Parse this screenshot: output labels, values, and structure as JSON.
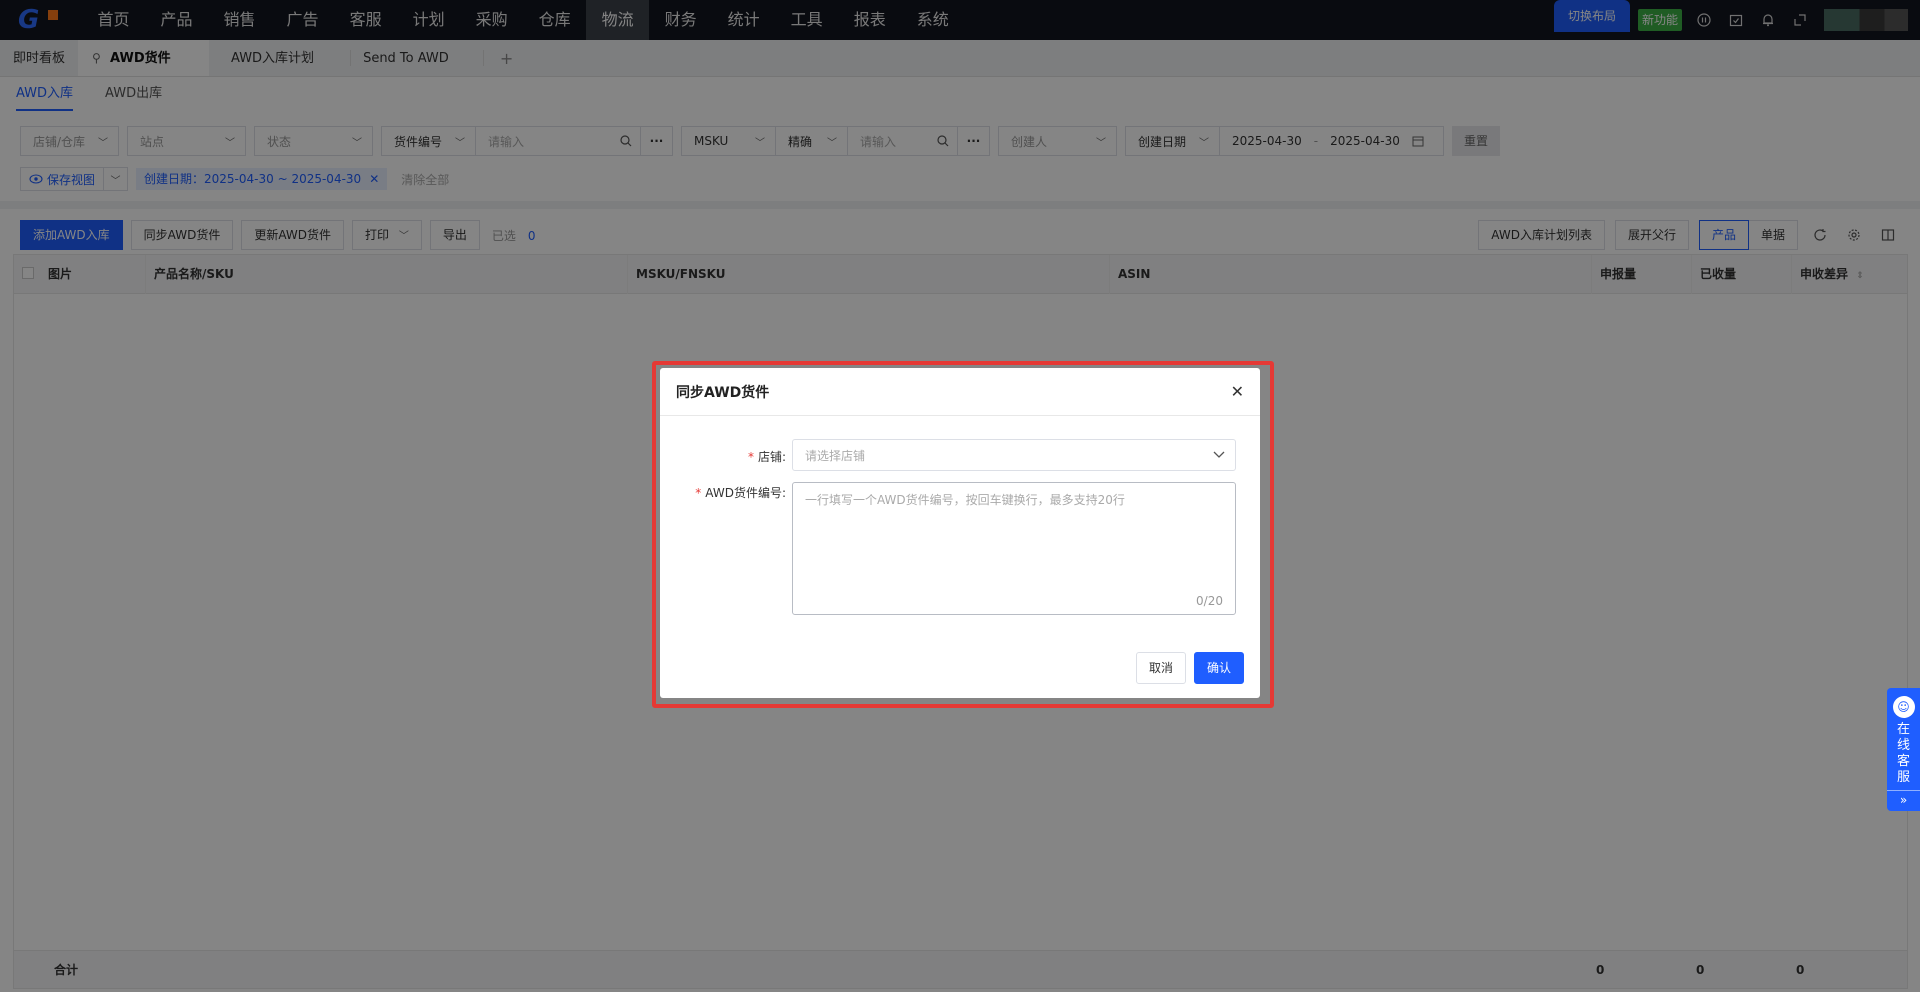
{
  "nav": {
    "items": [
      "首页",
      "产品",
      "销售",
      "广告",
      "客服",
      "计划",
      "采购",
      "仓库",
      "物流",
      "财务",
      "统计",
      "工具",
      "报表",
      "系统"
    ],
    "active_index": 8,
    "switch_layout": "切换布局",
    "new_feature": "新功能"
  },
  "tabs": {
    "items": [
      "即时看板",
      "AWD货件",
      "AWD入库计划",
      "Send To AWD"
    ],
    "add": "+"
  },
  "subtabs": [
    "AWD入库",
    "AWD出库"
  ],
  "filters": {
    "store_placeholder": "店铺/仓库",
    "site_placeholder": "站点",
    "status_placeholder": "状态",
    "shipment_type": "货件编号",
    "shipment_input_placeholder": "请输入",
    "msku_type": "MSKU",
    "match_mode": "精确",
    "msku_input_placeholder": "请输入",
    "creator_placeholder": "创建人",
    "date_type": "创建日期",
    "date_start": "2025-04-30",
    "date_sep": "-",
    "date_end": "2025-04-30",
    "reset": "重置",
    "save_view": "保存视图",
    "chip_label": "创建日期：2025-04-30 ~ 2025-04-30",
    "clear_all": "清除全部"
  },
  "toolbar": {
    "add": "添加AWD入库",
    "sync": "同步AWD货件",
    "update": "更新AWD货件",
    "print": "打印",
    "export": "导出",
    "selected_label": "已选",
    "selected_count": "0",
    "plan_list": "AWD入库计划列表",
    "expand_parent": "展开父行",
    "view_product": "产品",
    "view_doc": "单据"
  },
  "table": {
    "headers": [
      "图片",
      "产品名称/SKU",
      "MSKU/FNSKU",
      "ASIN",
      "申报量",
      "已收量",
      "申收差异"
    ],
    "footer_label": "合计",
    "footer_values": [
      "0",
      "0",
      "0"
    ]
  },
  "modal": {
    "title": "同步AWD货件",
    "store_label": "店铺:",
    "store_placeholder": "请选择店铺",
    "shipment_label": "AWD货件编号:",
    "shipment_placeholder": "一行填写一个AWD货件编号，按回车键换行，最多支持20行",
    "counter": "0/20",
    "cancel": "取消",
    "confirm": "确认"
  },
  "support_widget": {
    "text": "在线客服",
    "more": "»"
  },
  "colors": {
    "accent": "#1f5eff",
    "nav_bg": "#13161f",
    "highlight": "#e53935",
    "new_badge": "#3cb046"
  }
}
